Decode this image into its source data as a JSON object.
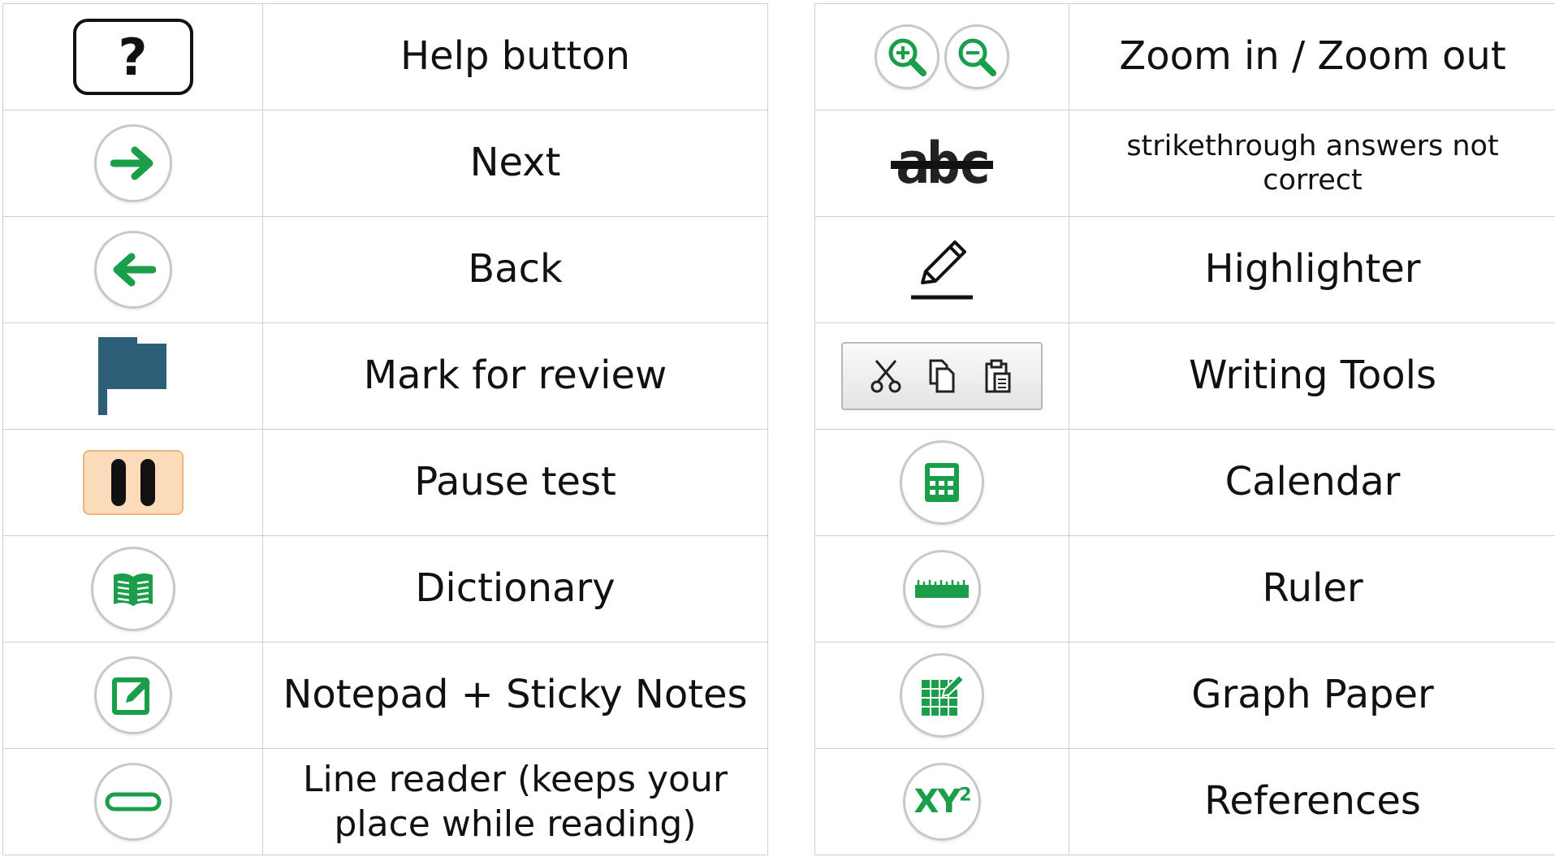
{
  "left_rows": [
    {
      "icon": "help-icon",
      "icon_text": "?",
      "label": "Help button"
    },
    {
      "icon": "arrow-right-icon",
      "label": "Next"
    },
    {
      "icon": "arrow-left-icon",
      "label": "Back"
    },
    {
      "icon": "flag-icon",
      "label": "Mark for review"
    },
    {
      "icon": "pause-icon",
      "label": "Pause test"
    },
    {
      "icon": "book-icon",
      "label": "Dictionary"
    },
    {
      "icon": "edit-note-icon",
      "label": "Notepad + Sticky Notes"
    },
    {
      "icon": "line-reader-icon",
      "label": "Line reader (keeps your place while reading)"
    }
  ],
  "right_rows": [
    {
      "icon": "zoom-in-zoom-out-icon",
      "label": "Zoom in / Zoom out"
    },
    {
      "icon": "strikethrough-icon",
      "icon_text": "abc",
      "label": "strikethrough answers not correct"
    },
    {
      "icon": "pencil-icon",
      "label": "Highlighter"
    },
    {
      "icon": "writing-tools-icon",
      "label": "Writing Tools"
    },
    {
      "icon": "calculator-icon",
      "label": "Calendar"
    },
    {
      "icon": "ruler-icon",
      "label": "Ruler"
    },
    {
      "icon": "graph-paper-icon",
      "label": "Graph Paper"
    },
    {
      "icon": "xy-squared-icon",
      "icon_text": "XY",
      "icon_sup": "2",
      "label": "References"
    }
  ],
  "colors": {
    "green": "#1a9e4a",
    "flag": "#2e5f78",
    "pause_bg": "#fcdcb8",
    "border": "#d0d0d0"
  }
}
